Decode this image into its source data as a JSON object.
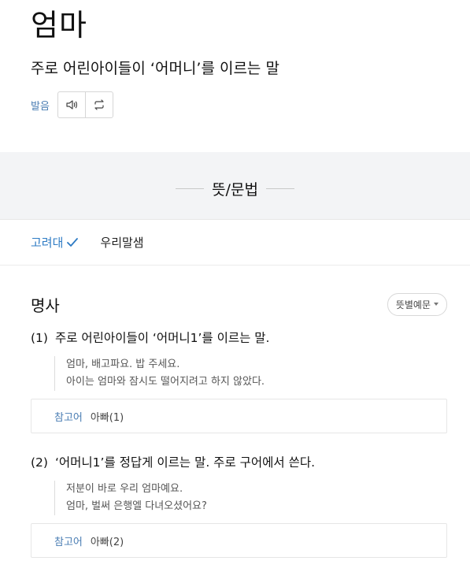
{
  "entry": {
    "word": "엄마",
    "definition": "주로 어린아이들이 ‘어머니’를 이르는 말",
    "pron_label": "발음"
  },
  "section": {
    "title": "뜻/문법"
  },
  "tabs": [
    {
      "label": "고려대",
      "active": true
    },
    {
      "label": "우리말샘",
      "active": false
    }
  ],
  "pos": {
    "label": "명사",
    "example_toggle": "뜻별예문"
  },
  "senses": [
    {
      "num": "(1)",
      "text": "주로 어린아이들이 ‘어머니1’를 이르는 말.",
      "examples": [
        "엄마, 배고파요. 밥 주세요.",
        "아이는 엄마와 잠시도 떨어지려고 하지 않았다."
      ],
      "ref_label": "참고어",
      "ref_value": "아빠(1)"
    },
    {
      "num": "(2)",
      "text": "‘어머니1’를 정답게 이르는 말. 주로 구어에서 쓴다.",
      "examples": [
        "저분이 바로 우리 엄마예요.",
        "엄마, 벌써 은행엘 다녀오셨어요?"
      ],
      "ref_label": "참고어",
      "ref_value": "아빠(2)"
    }
  ],
  "icons": {
    "speaker": "speaker-icon",
    "repeat": "repeat-icon",
    "check": "check-icon"
  },
  "colors": {
    "accent": "#2e7bc4",
    "muted_link": "#4a7db3"
  }
}
